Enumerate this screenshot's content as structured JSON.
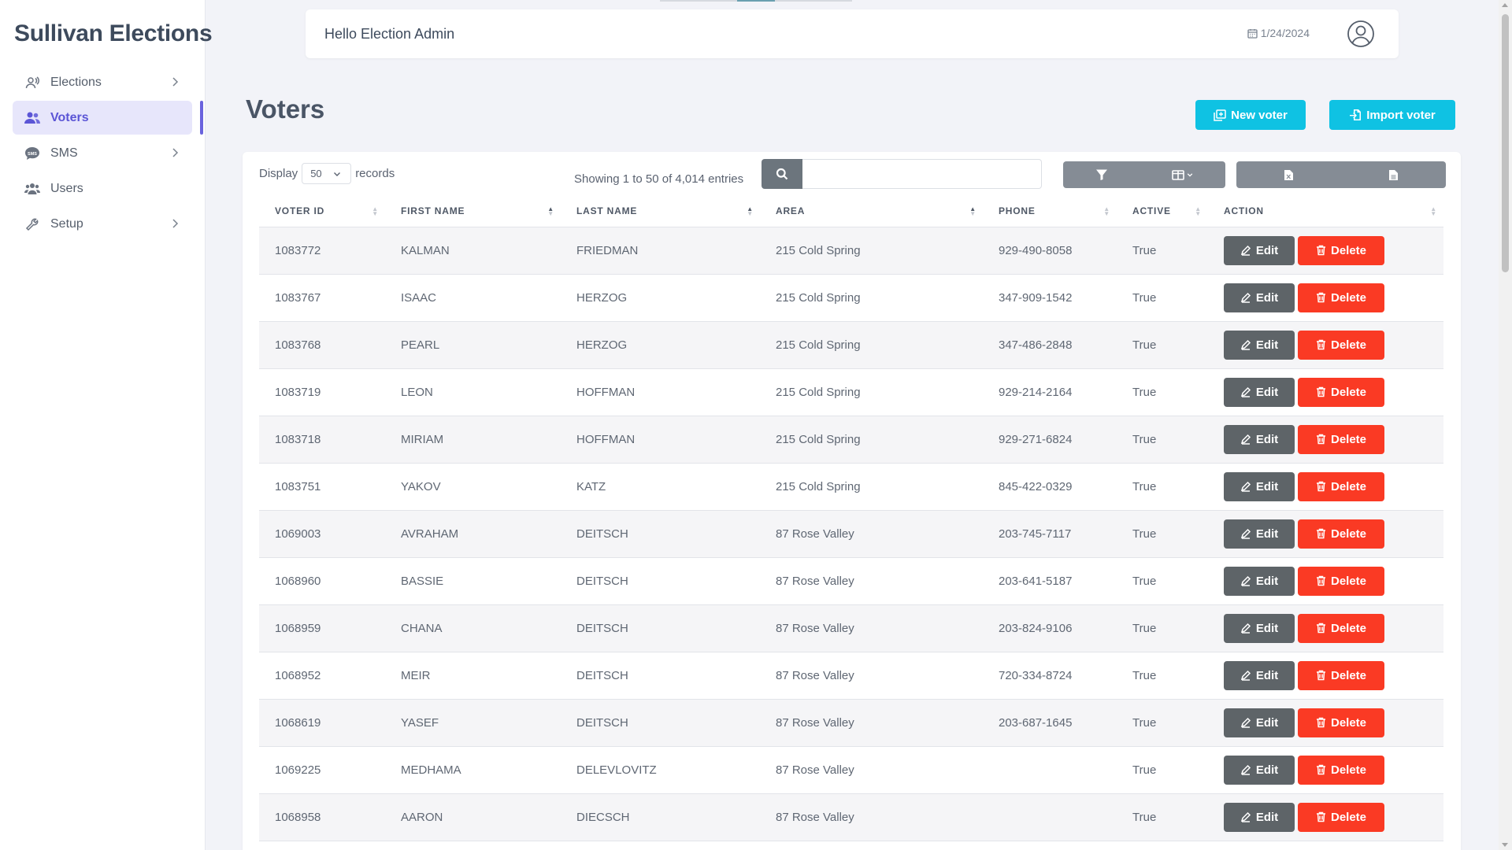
{
  "app": {
    "brand": "Sullivan Elections"
  },
  "sidebar": {
    "items": [
      {
        "label": "Elections",
        "icon": "elections-icon",
        "has_children": true,
        "active": false
      },
      {
        "label": "Voters",
        "icon": "users-icon",
        "has_children": false,
        "active": true
      },
      {
        "label": "SMS",
        "icon": "sms-icon",
        "has_children": true,
        "active": false
      },
      {
        "label": "Users",
        "icon": "users-group-icon",
        "has_children": false,
        "active": false
      },
      {
        "label": "Setup",
        "icon": "wrench-icon",
        "has_children": true,
        "active": false
      }
    ]
  },
  "topbar": {
    "greeting": "Hello Election Admin",
    "date": "1/24/2024",
    "user_icon": "user-circle-icon"
  },
  "page": {
    "title": "Voters",
    "new_button": "New voter",
    "import_button": "Import voter"
  },
  "table_controls": {
    "display_label": "Display",
    "records_label": "records",
    "page_size": "50",
    "showing": "Showing 1 to 50 of 4,014 entries",
    "search_value": ""
  },
  "table": {
    "columns": [
      "VOTER ID",
      "FIRST NAME",
      "LAST NAME",
      "AREA",
      "PHONE",
      "ACTIVE",
      "ACTION"
    ],
    "edit_label": "Edit",
    "delete_label": "Delete",
    "rows": [
      {
        "id": "1083772",
        "first": "KALMAN",
        "last": "FRIEDMAN",
        "area": "215 Cold Spring",
        "phone": "929-490-8058",
        "active": "True"
      },
      {
        "id": "1083767",
        "first": "ISAAC",
        "last": "HERZOG",
        "area": "215 Cold Spring",
        "phone": "347-909-1542",
        "active": "True"
      },
      {
        "id": "1083768",
        "first": "PEARL",
        "last": "HERZOG",
        "area": "215 Cold Spring",
        "phone": "347-486-2848",
        "active": "True"
      },
      {
        "id": "1083719",
        "first": "LEON",
        "last": "HOFFMAN",
        "area": "215 Cold Spring",
        "phone": "929-214-2164",
        "active": "True"
      },
      {
        "id": "1083718",
        "first": "MIRIAM",
        "last": "HOFFMAN",
        "area": "215 Cold Spring",
        "phone": "929-271-6824",
        "active": "True"
      },
      {
        "id": "1083751",
        "first": "YAKOV",
        "last": "KATZ",
        "area": "215 Cold Spring",
        "phone": "845-422-0329",
        "active": "True"
      },
      {
        "id": "1069003",
        "first": "AVRAHAM",
        "last": "DEITSCH",
        "area": "87 Rose Valley",
        "phone": "203-745-7117",
        "active": "True"
      },
      {
        "id": "1068960",
        "first": "BASSIE",
        "last": "DEITSCH",
        "area": "87 Rose Valley",
        "phone": "203-641-5187",
        "active": "True"
      },
      {
        "id": "1068959",
        "first": "CHANA",
        "last": "DEITSCH",
        "area": "87 Rose Valley",
        "phone": "203-824-9106",
        "active": "True"
      },
      {
        "id": "1068952",
        "first": "MEIR",
        "last": "DEITSCH",
        "area": "87 Rose Valley",
        "phone": "720-334-8724",
        "active": "True"
      },
      {
        "id": "1068619",
        "first": "YASEF",
        "last": "DEITSCH",
        "area": "87 Rose Valley",
        "phone": "203-687-1645",
        "active": "True"
      },
      {
        "id": "1069225",
        "first": "MEDHAMA",
        "last": "DELEVLOVITZ",
        "area": "87 Rose Valley",
        "phone": "",
        "active": "True"
      },
      {
        "id": "1068958",
        "first": "AARON",
        "last": "DIECSCH",
        "area": "87 Rose Valley",
        "phone": "",
        "active": "True"
      }
    ]
  },
  "colors": {
    "accent": "#6a63dd",
    "cyan": "#0fc2e3",
    "danger": "#fa3a24",
    "secondary": "#5e6468"
  }
}
